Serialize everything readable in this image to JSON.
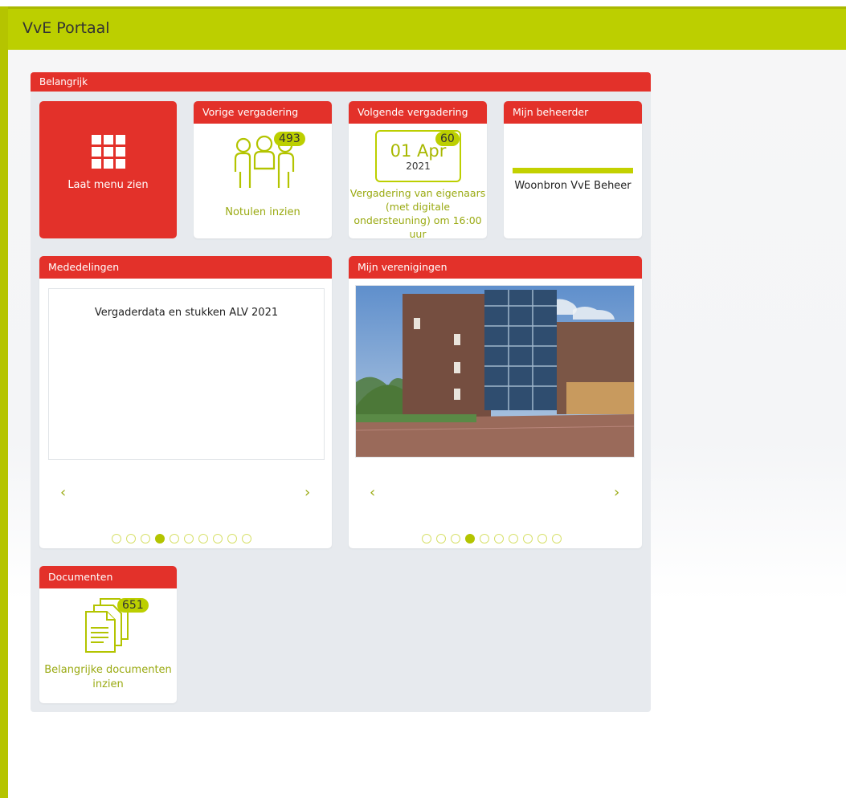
{
  "app": {
    "title": "VvE Portaal"
  },
  "board": {
    "title": "Belangrijk"
  },
  "menu_tile": {
    "label": "Laat menu zien",
    "icon": "grid-icon"
  },
  "vorige": {
    "title": "Vorige vergadering",
    "badge": "493",
    "label": "Notulen inzien",
    "icon": "people-meeting-icon"
  },
  "volgende": {
    "title": "Volgende vergadering",
    "day": "01 Apr",
    "year": "2021",
    "badge": "60",
    "text": "Vergadering van eigenaars (met digitale ondersteuning) om 16:00 uur"
  },
  "beheerder": {
    "title": "Mijn beheerder",
    "name": "Woonbron VvE Beheer"
  },
  "mededelingen": {
    "title": "Mededelingen",
    "item": "Vergaderdata en stukken ALV 2021",
    "prev": "‹",
    "next": "›",
    "dot_count": 10,
    "active_dot": 4
  },
  "verenigingen": {
    "title": "Mijn verenigingen",
    "prev": "‹",
    "next": "›",
    "dot_count": 10,
    "active_dot": 4
  },
  "documenten": {
    "title": "Documenten",
    "badge": "651",
    "label": "Belangrijke documenten inzien",
    "icon": "documents-icon"
  },
  "colors": {
    "brand_green": "#bccf00",
    "red": "#e3312a",
    "text_green": "#9aaa12"
  }
}
